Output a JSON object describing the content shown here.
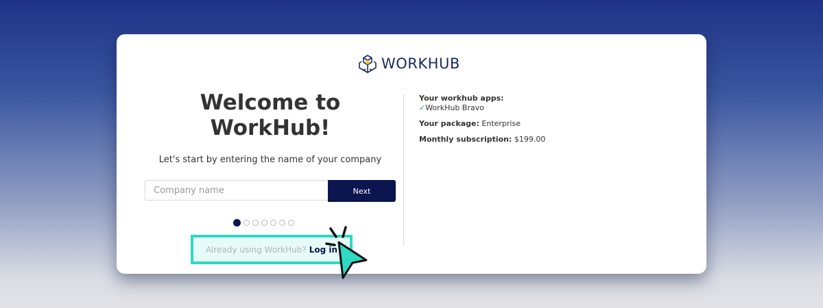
{
  "brand": {
    "name": "WORKHUB",
    "logo_icon": "cube-cluster-icon",
    "color": "#1b2a5c"
  },
  "main": {
    "heading_line1": "Welcome to",
    "heading_line2": "WorkHub!",
    "subtitle": "Let's start by entering the name of your company",
    "company_input": {
      "placeholder": "Company name",
      "value": ""
    },
    "next_label": "Next",
    "steps": {
      "total": 7,
      "current": 1
    },
    "login_prompt": "Already using WorkHub?",
    "login_link": "Log in"
  },
  "summary": {
    "apps_label": "Your workhub apps:",
    "apps": [
      {
        "check": "✓",
        "name": "WorkHub Bravo"
      }
    ],
    "package_label": "Your package:",
    "package_value": "Enterprise",
    "subscription_label": "Monthly subscription:",
    "subscription_value": "$199.00"
  },
  "colors": {
    "accent": "#0b1650",
    "highlight": "#2fd9c3",
    "check": "#2ea24a"
  }
}
